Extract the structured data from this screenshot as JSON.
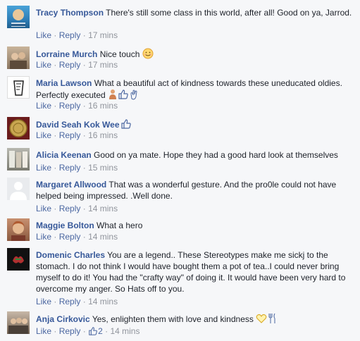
{
  "actions": {
    "like": "Like",
    "reply": "Reply",
    "dot": "·"
  },
  "comments": [
    {
      "author": "Tracy Thompson",
      "text": "There's still some class in this world, after all! Good on ya, Jarrod.",
      "time": "17 mins"
    },
    {
      "author": "Lorraine Murch",
      "text": "Nice touch",
      "time": "17 mins"
    },
    {
      "author": "Maria Lawson",
      "text": "What a beautiful act of kindness towards these uneducated oldies. Perfectly executed",
      "time": "16 mins"
    },
    {
      "author": "David Seah Kok Wee",
      "text": "",
      "time": "16 mins"
    },
    {
      "author": "Alicia Keenan",
      "text": "Good on ya mate. Hope they had a good hard look at themselves",
      "time": "15 mins"
    },
    {
      "author": "Margaret Allwood",
      "text": "That was a wonderful gesture. And the pro0le could not have helped being impressed. .Well done.",
      "time": "14 mins"
    },
    {
      "author": "Maggie Bolton",
      "text": "What a hero",
      "time": "14 mins"
    },
    {
      "author": "Domenic Charles",
      "text": "You are a legend.. These Stereotypes make me sickj to the stomach. I do not think I would have bought them a pot of tea..I could never bring myself to do it! You had the \"crafty way\" of doing it. It would have been very hard to overcome my anger. So Hats off to you.",
      "time": "14 mins"
    },
    {
      "author": "Anja Cirkovic",
      "text": "Yes, enlighten them with love and kindness",
      "time": "14 mins",
      "likes": "2"
    }
  ]
}
